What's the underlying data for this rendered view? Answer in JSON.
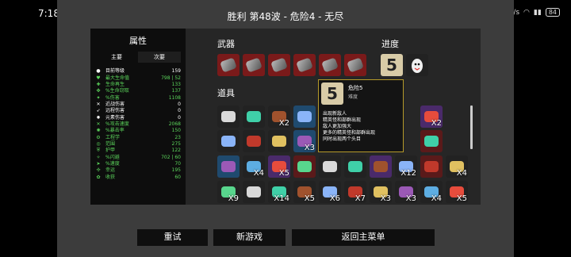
{
  "status_bar": {
    "time": "7:18",
    "net_speed": "19 K/s",
    "battery": "84"
  },
  "title": "胜利    第48波 - 危险4 - 无尽",
  "attributes": {
    "title": "属性",
    "tab_main": "主要",
    "tab_secondary": "次要",
    "rows": [
      {
        "label": "目前等级",
        "value": "159",
        "color": "#ffffff",
        "icon": "level-icon"
      },
      {
        "label": "最大生命值",
        "value": "798 | 52",
        "color": "#5cd65c",
        "icon": "heart-icon"
      },
      {
        "label": "生命再生",
        "value": "133",
        "color": "#5cd65c",
        "icon": "regen-icon"
      },
      {
        "label": "%生命窃取",
        "value": "137",
        "color": "#5cd65c",
        "icon": "lifesteal-icon"
      },
      {
        "label": "%伤害",
        "value": "1108",
        "color": "#5cd65c",
        "icon": "damage-icon"
      },
      {
        "label": "近战伤害",
        "value": "0",
        "color": "#ffffff",
        "icon": "melee-icon"
      },
      {
        "label": "远程伤害",
        "value": "0",
        "color": "#ffffff",
        "icon": "ranged-icon"
      },
      {
        "label": "元素伤害",
        "value": "0",
        "color": "#ffffff",
        "icon": "elemental-icon"
      },
      {
        "label": "%攻击速度",
        "value": "2068",
        "color": "#5cd65c",
        "icon": "attack-speed-icon"
      },
      {
        "label": "%暴击率",
        "value": "150",
        "color": "#5cd65c",
        "icon": "crit-icon"
      },
      {
        "label": "工程学",
        "value": "23",
        "color": "#5cd65c",
        "icon": "engineering-icon"
      },
      {
        "label": "范围",
        "value": "275",
        "color": "#5cd65c",
        "icon": "range-icon"
      },
      {
        "label": "护甲",
        "value": "122",
        "color": "#5cd65c",
        "icon": "armor-icon"
      },
      {
        "label": "%闪避",
        "value": "702 | 60",
        "color": "#5cd65c",
        "icon": "dodge-icon"
      },
      {
        "label": "%速度",
        "value": "70",
        "color": "#5cd65c",
        "icon": "speed-icon"
      },
      {
        "label": "幸运",
        "value": "195",
        "color": "#5cd65c",
        "icon": "luck-icon"
      },
      {
        "label": "收获",
        "value": "60",
        "color": "#5cd65c",
        "icon": "harvest-icon"
      }
    ]
  },
  "weapons": {
    "title": "武器",
    "items": [
      {
        "name": "minigun-icon"
      },
      {
        "name": "minigun-icon"
      },
      {
        "name": "minigun-icon"
      },
      {
        "name": "minigun-icon"
      },
      {
        "name": "minigun-icon"
      },
      {
        "name": "minigun-icon"
      }
    ]
  },
  "progress": {
    "title": "进度",
    "danger_number": "5"
  },
  "items": {
    "title": "道具",
    "rows": [
      [
        {
          "c": "#222222",
          "cnt": ""
        },
        {
          "c": "#222222",
          "cnt": ""
        },
        {
          "c": "#222222",
          "cnt": "X2"
        },
        {
          "c": "#1f4a6e",
          "cnt": ""
        },
        {
          "c": "#222222",
          "cnt": ""
        },
        {
          "c": "#222222",
          "cnt": ""
        },
        {
          "c": "#222222",
          "cnt": ""
        },
        {
          "c": "#4a2a6a",
          "cnt": "X3"
        },
        {
          "c": "#4a2a6a",
          "cnt": "X2"
        }
      ],
      [
        {
          "c": "#222222",
          "cnt": ""
        },
        {
          "c": "#222222",
          "cnt": ""
        },
        {
          "c": "#222222",
          "cnt": ""
        },
        {
          "c": "#1f4a6e",
          "cnt": "X3"
        },
        {
          "c": "#222222",
          "cnt": ""
        },
        {
          "c": "#222222",
          "cnt": ""
        },
        {
          "c": "#222222",
          "cnt": "X2"
        },
        {
          "c": "#1f4a6e",
          "cnt": ""
        },
        {
          "c": "#5a1a1a",
          "cnt": ""
        }
      ],
      [
        {
          "c": "#1f4a6e",
          "cnt": ""
        },
        {
          "c": "#222222",
          "cnt": "X4"
        },
        {
          "c": "#4a2a6a",
          "cnt": "X5"
        },
        {
          "c": "#5a1a1a",
          "cnt": ""
        },
        {
          "c": "#222222",
          "cnt": ""
        },
        {
          "c": "#222222",
          "cnt": ""
        },
        {
          "c": "#4a2a6a",
          "cnt": ""
        },
        {
          "c": "#222222",
          "cnt": "X12"
        },
        {
          "c": "#5a1a1a",
          "cnt": ""
        },
        {
          "c": "#222222",
          "cnt": "X4"
        }
      ],
      [
        {
          "c": "#222222",
          "cnt": "X9"
        },
        {
          "c": "#222222",
          "cnt": ""
        },
        {
          "c": "#222222",
          "cnt": "X14"
        },
        {
          "c": "#222222",
          "cnt": "X5"
        },
        {
          "c": "#222222",
          "cnt": "X6"
        },
        {
          "c": "#222222",
          "cnt": "X7"
        },
        {
          "c": "#222222",
          "cnt": "X3"
        },
        {
          "c": "#222222",
          "cnt": "X3"
        },
        {
          "c": "#222222",
          "cnt": "X4"
        },
        {
          "c": "#222222",
          "cnt": "X5"
        }
      ]
    ]
  },
  "tooltip": {
    "number": "5",
    "name": "危险5",
    "subtitle": "难度",
    "lines": [
      "出现新敌人",
      "精英怪和部群出现",
      "敌人更加强大",
      "更多的精英怪和部群出现",
      "同时出现两个头目"
    ]
  },
  "buttons": {
    "retry": "重试",
    "new_game": "新游戏",
    "main_menu": "返回主菜单"
  },
  "colors": {
    "weapon_slot": "#7a1a1a",
    "progress_slot": "#d8cba7",
    "tooltip_border": "#b59a2a"
  }
}
